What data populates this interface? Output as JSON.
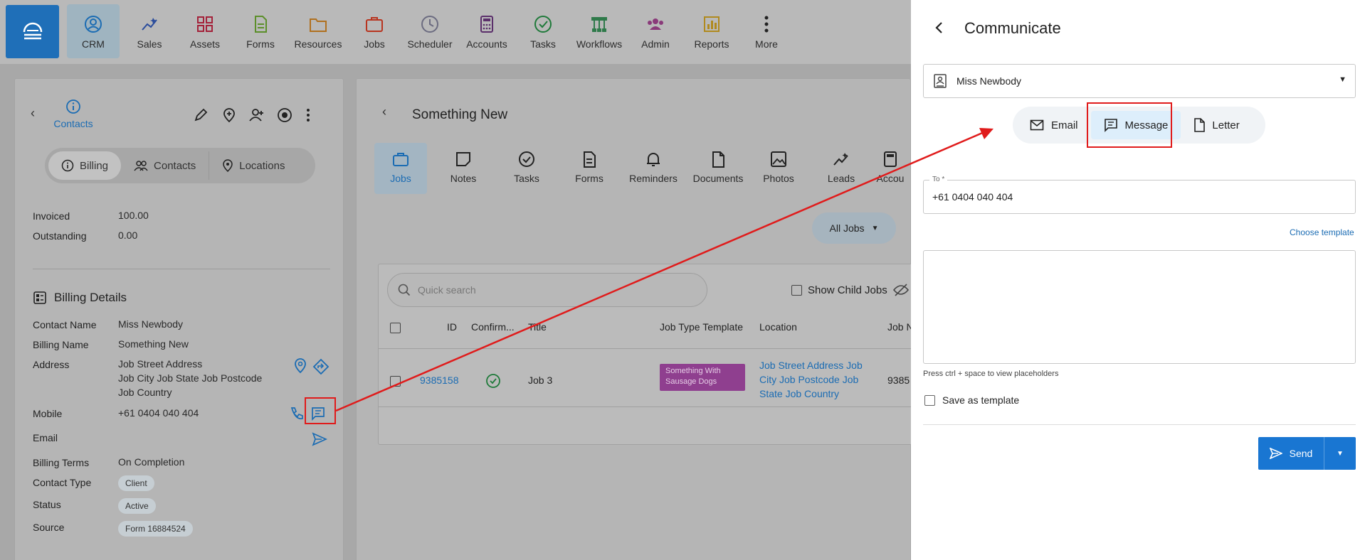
{
  "nav": {
    "items": [
      {
        "label": "CRM",
        "icon": "crm-icon"
      },
      {
        "label": "Sales",
        "icon": "sales-icon"
      },
      {
        "label": "Assets",
        "icon": "assets-icon"
      },
      {
        "label": "Forms",
        "icon": "forms-icon"
      },
      {
        "label": "Resources",
        "icon": "resources-icon"
      },
      {
        "label": "Jobs",
        "icon": "jobs-icon"
      },
      {
        "label": "Scheduler",
        "icon": "scheduler-icon"
      },
      {
        "label": "Accounts",
        "icon": "accounts-icon"
      },
      {
        "label": "Tasks",
        "icon": "tasks-icon"
      },
      {
        "label": "Workflows",
        "icon": "workflows-icon"
      },
      {
        "label": "Admin",
        "icon": "admin-icon"
      },
      {
        "label": "Reports",
        "icon": "reports-icon"
      },
      {
        "label": "More",
        "icon": "more-icon"
      }
    ]
  },
  "left": {
    "back_label": "Contacts",
    "segments": [
      "Billing",
      "Contacts",
      "Locations"
    ],
    "invoiced_label": "Invoiced",
    "invoiced_value": "100.00",
    "outstanding_label": "Outstanding",
    "outstanding_value": "0.00",
    "section_title": "Billing Details",
    "contact_name_label": "Contact Name",
    "contact_name_value": "Miss Newbody",
    "billing_name_label": "Billing Name",
    "billing_name_value": "Something New",
    "address_label": "Address",
    "address_line1": "Job Street Address",
    "address_line2": "Job City Job State Job Postcode",
    "address_line3": "Job Country",
    "mobile_label": "Mobile",
    "mobile_value": "+61 0404 040 404",
    "email_label": "Email",
    "billing_terms_label": "Billing Terms",
    "billing_terms_value": "On Completion",
    "contact_type_label": "Contact Type",
    "contact_type_value": "Client",
    "status_label": "Status",
    "status_value": "Active",
    "source_label": "Source",
    "source_value": "Form 16884524"
  },
  "center": {
    "title": "Something New",
    "tabs": [
      "Jobs",
      "Notes",
      "Tasks",
      "Forms",
      "Reminders",
      "Documents",
      "Photos",
      "Leads",
      "Accou"
    ],
    "filter_label": "All Jobs",
    "search_placeholder": "Quick search",
    "show_child_label": "Show Child Jobs",
    "columns": [
      "ID",
      "Confirm...",
      "Title",
      "Job Type Template",
      "Location",
      "Job N"
    ],
    "row": {
      "id": "9385158",
      "title": "Job 3",
      "template_line1": "Something With",
      "template_line2": "Sausage Dogs",
      "location_line1": "Job Street Address Job",
      "location_line2": "City Job Postcode Job",
      "location_line3": "State Job Country",
      "job_n": "9385"
    },
    "colors": {
      "template_chip": "#8f3f8f",
      "link": "#1b6cb3"
    }
  },
  "drawer": {
    "title": "Communicate",
    "contact": "Miss Newbody",
    "modes": [
      "Email",
      "Message",
      "Letter"
    ],
    "to_label": "To *",
    "to_value": "+61 0404 040 404",
    "choose_template": "Choose template",
    "hint": "Press ctrl + space to view placeholders",
    "save_template": "Save as template",
    "send_label": "Send",
    "colors": {
      "send": "#1976d2",
      "highlight": "#e01b1b",
      "active_mode": "#ddeefb"
    }
  }
}
